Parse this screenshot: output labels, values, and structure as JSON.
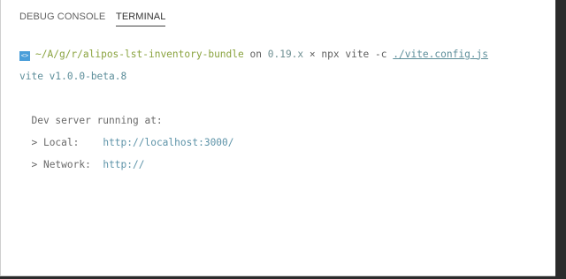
{
  "tabs": [
    {
      "label": "DEBUG CONSOLE"
    },
    {
      "label": "TERMINAL"
    }
  ],
  "prompt": {
    "badge": "<>",
    "path": "~/A/g/r/alipos-lst-inventory-bundle",
    "on_text": "on",
    "version": "0.19.x",
    "separator": "×",
    "command": "npx vite -c",
    "config_path": "./vite.config.js"
  },
  "output": {
    "vite_version": "vite v1.0.0-beta.8",
    "dev_server": "Dev server running at:",
    "local_label": "> Local:",
    "local_url": "http://localhost:3000/",
    "network_label": "> Network:",
    "network_url": "http://"
  }
}
